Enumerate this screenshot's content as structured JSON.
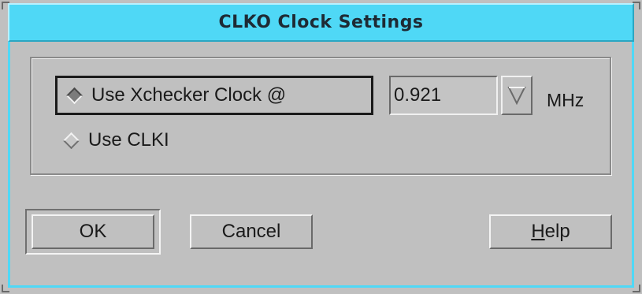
{
  "window": {
    "title": "CLKO Clock Settings"
  },
  "clock_source": {
    "options": [
      {
        "label": "Use Xchecker Clock @",
        "selected": true
      },
      {
        "label": "Use CLKI",
        "selected": false
      }
    ],
    "frequency": {
      "value": "0.921",
      "unit": "MHz"
    }
  },
  "buttons": {
    "ok": "OK",
    "cancel": "Cancel",
    "help_mnemonic": "H",
    "help_rest": "elp"
  },
  "icons": {
    "dropdown": "triangle-down-icon",
    "radio_selected": "radio-diamond-on-icon",
    "radio_unselected": "radio-diamond-off-icon"
  },
  "colors": {
    "titlebar": "#4fd8f6",
    "background": "#c0c0c0"
  }
}
